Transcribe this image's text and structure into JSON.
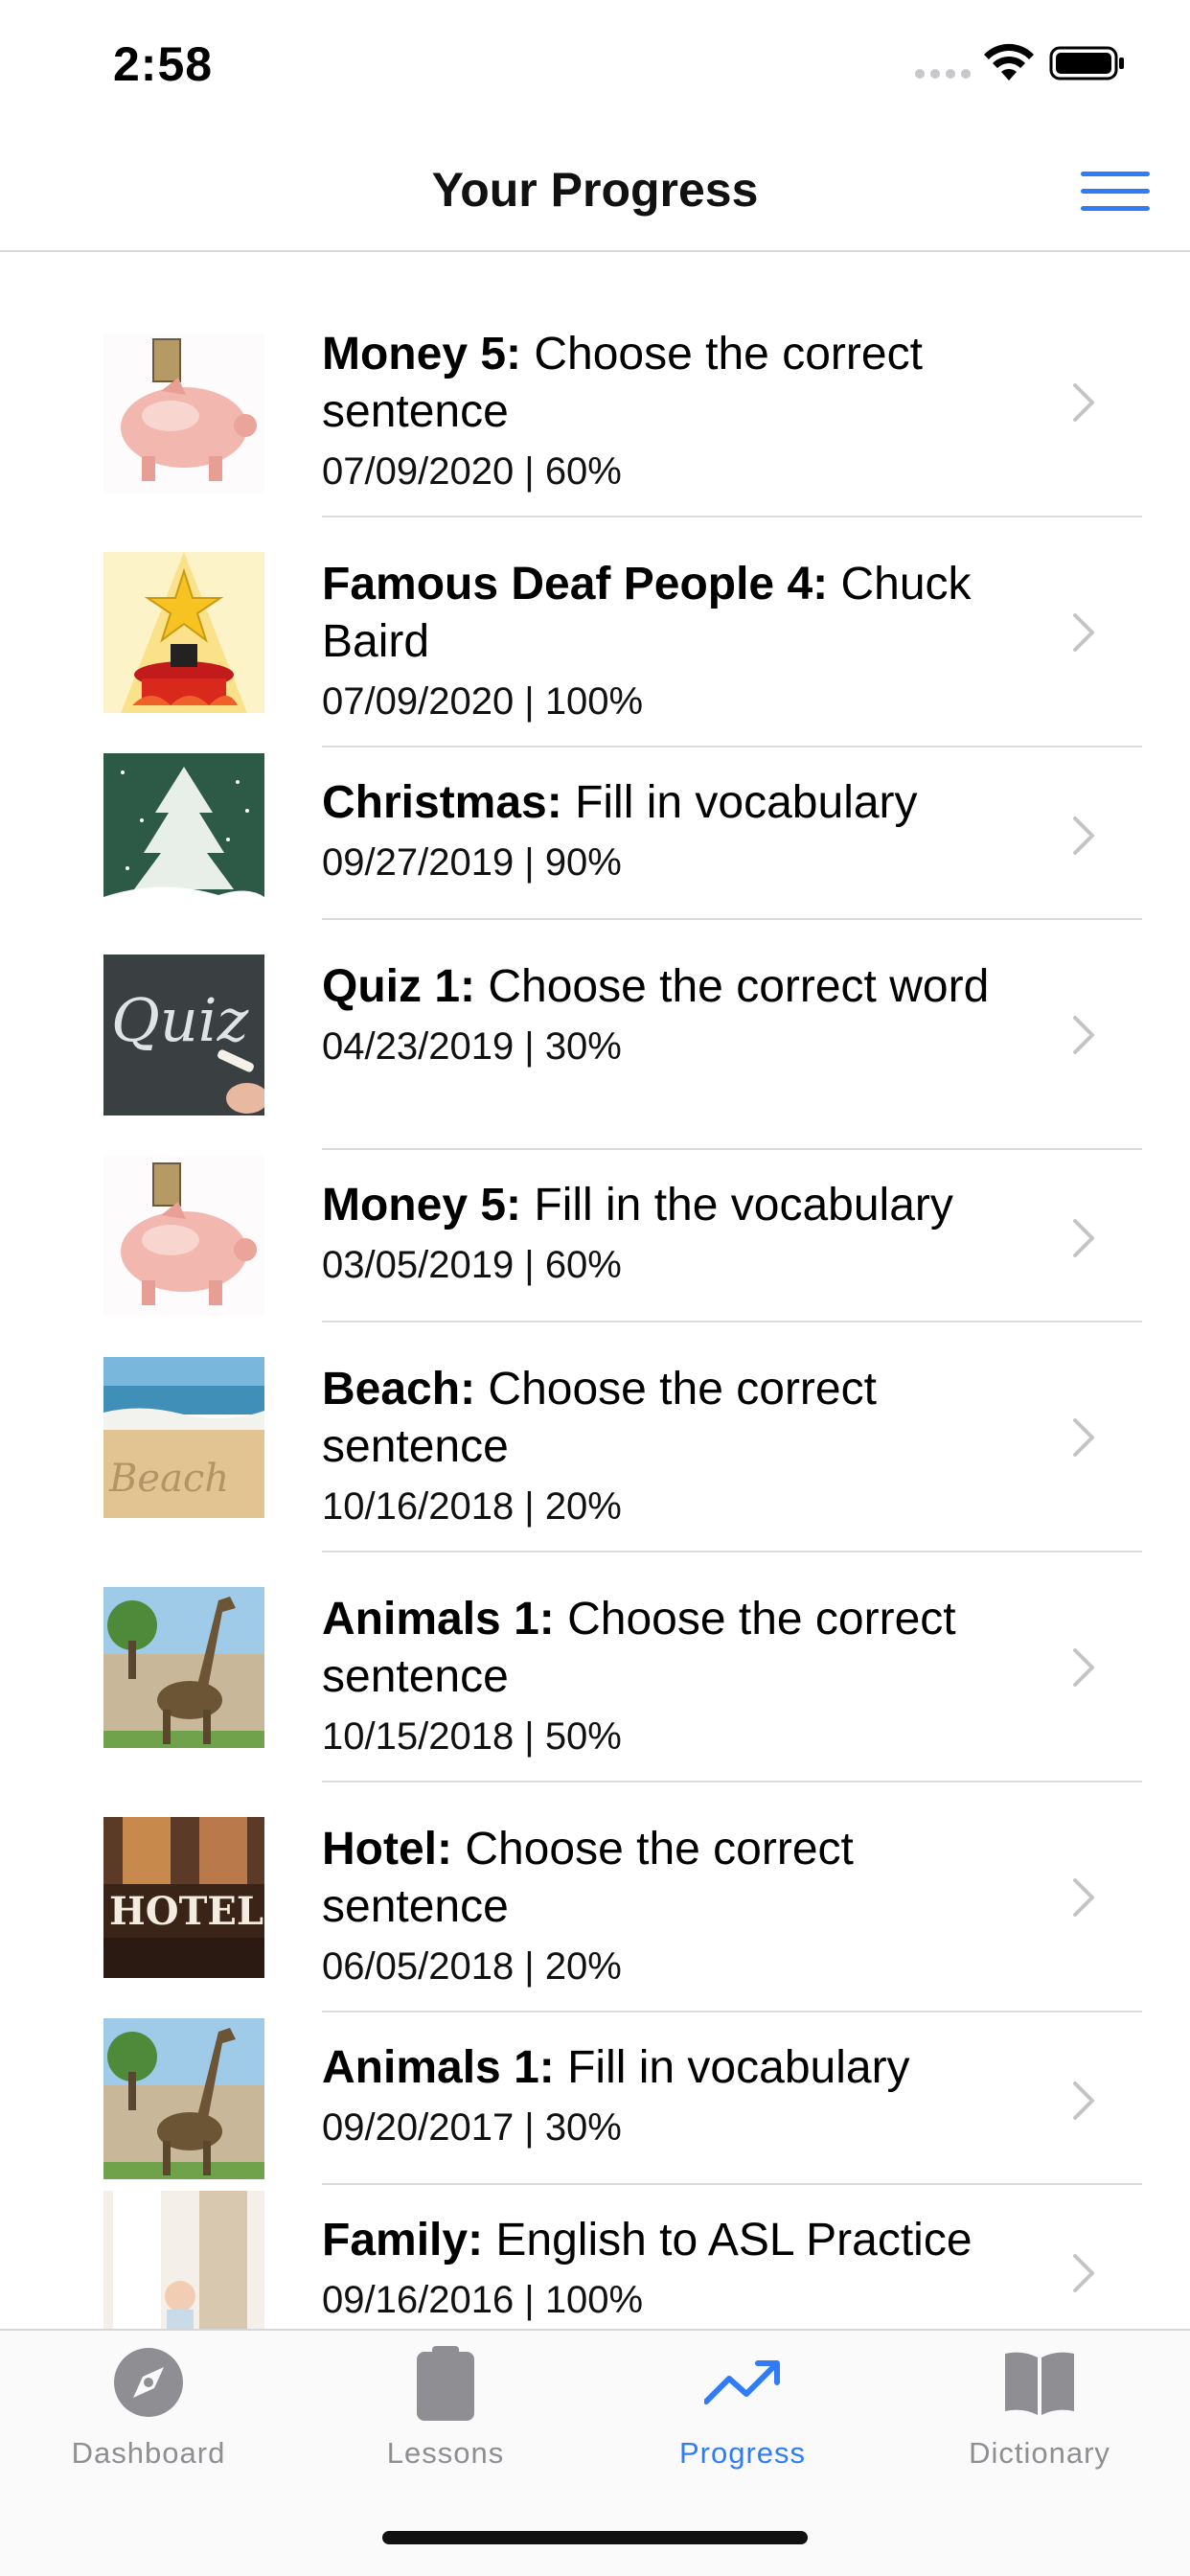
{
  "status_bar": {
    "time": "2:58"
  },
  "nav": {
    "title": "Your Progress",
    "menu_icon": "hamburger-menu-icon"
  },
  "lessons": [
    {
      "title_bold": "Money 5:",
      "title_rest": " Choose the correct sentence",
      "date": "07/09/2020",
      "score": "60%",
      "meta": "07/09/2020 | 60%",
      "thumbnail": "piggy-bank-icon"
    },
    {
      "title_bold": "Famous Deaf People 4:",
      "title_rest": " Chuck Baird",
      "date": "07/09/2020",
      "score": "100%",
      "meta": "07/09/2020 | 100%",
      "thumbnail": "star-spotlight-icon"
    },
    {
      "title_bold": "Christmas:",
      "title_rest": " Fill in vocabulary",
      "date": "09/27/2019",
      "score": "90%",
      "meta": "09/27/2019 | 90%",
      "thumbnail": "christmas-tree-icon"
    },
    {
      "title_bold": "Quiz 1:",
      "title_rest": " Choose the correct word",
      "date": "04/23/2019",
      "score": "30%",
      "meta": "04/23/2019 | 30%",
      "thumbnail": "chalkboard-quiz-icon"
    },
    {
      "title_bold": "Money 5:",
      "title_rest": " Fill in the vocabulary",
      "date": "03/05/2019",
      "score": "60%",
      "meta": "03/05/2019 | 60%",
      "thumbnail": "piggy-bank-icon"
    },
    {
      "title_bold": "Beach:",
      "title_rest": " Choose the correct sentence",
      "date": "10/16/2018",
      "score": "20%",
      "meta": "10/16/2018 | 20%",
      "thumbnail": "beach-sand-icon"
    },
    {
      "title_bold": "Animals 1:",
      "title_rest": " Choose the correct sentence",
      "date": "10/15/2018",
      "score": "50%",
      "meta": "10/15/2018 | 50%",
      "thumbnail": "giraffe-icon"
    },
    {
      "title_bold": "Hotel:",
      "title_rest": " Choose the correct sentence",
      "date": "06/05/2018",
      "score": "20%",
      "meta": "06/05/2018 | 20%",
      "thumbnail": "hotel-sign-icon"
    },
    {
      "title_bold": "Animals 1:",
      "title_rest": " Fill in vocabulary",
      "date": "09/20/2017",
      "score": "30%",
      "meta": "09/20/2017 | 30%",
      "thumbnail": "giraffe-icon"
    },
    {
      "title_bold": "Family:",
      "title_rest": " English to ASL Practice",
      "date": "09/16/2016",
      "score": "100%",
      "meta": "09/16/2016 | 100%",
      "thumbnail": "family-icon"
    }
  ],
  "tabs": [
    {
      "label": "Dashboard",
      "icon": "compass-icon",
      "active": false
    },
    {
      "label": "Lessons",
      "icon": "clipboard-icon",
      "active": false
    },
    {
      "label": "Progress",
      "icon": "trending-up-icon",
      "active": true
    },
    {
      "label": "Dictionary",
      "icon": "open-book-icon",
      "active": false
    }
  ],
  "colors": {
    "accent": "#2f7cf6",
    "inactive_tab": "#8e8e93",
    "divider": "#dcdcdf"
  }
}
